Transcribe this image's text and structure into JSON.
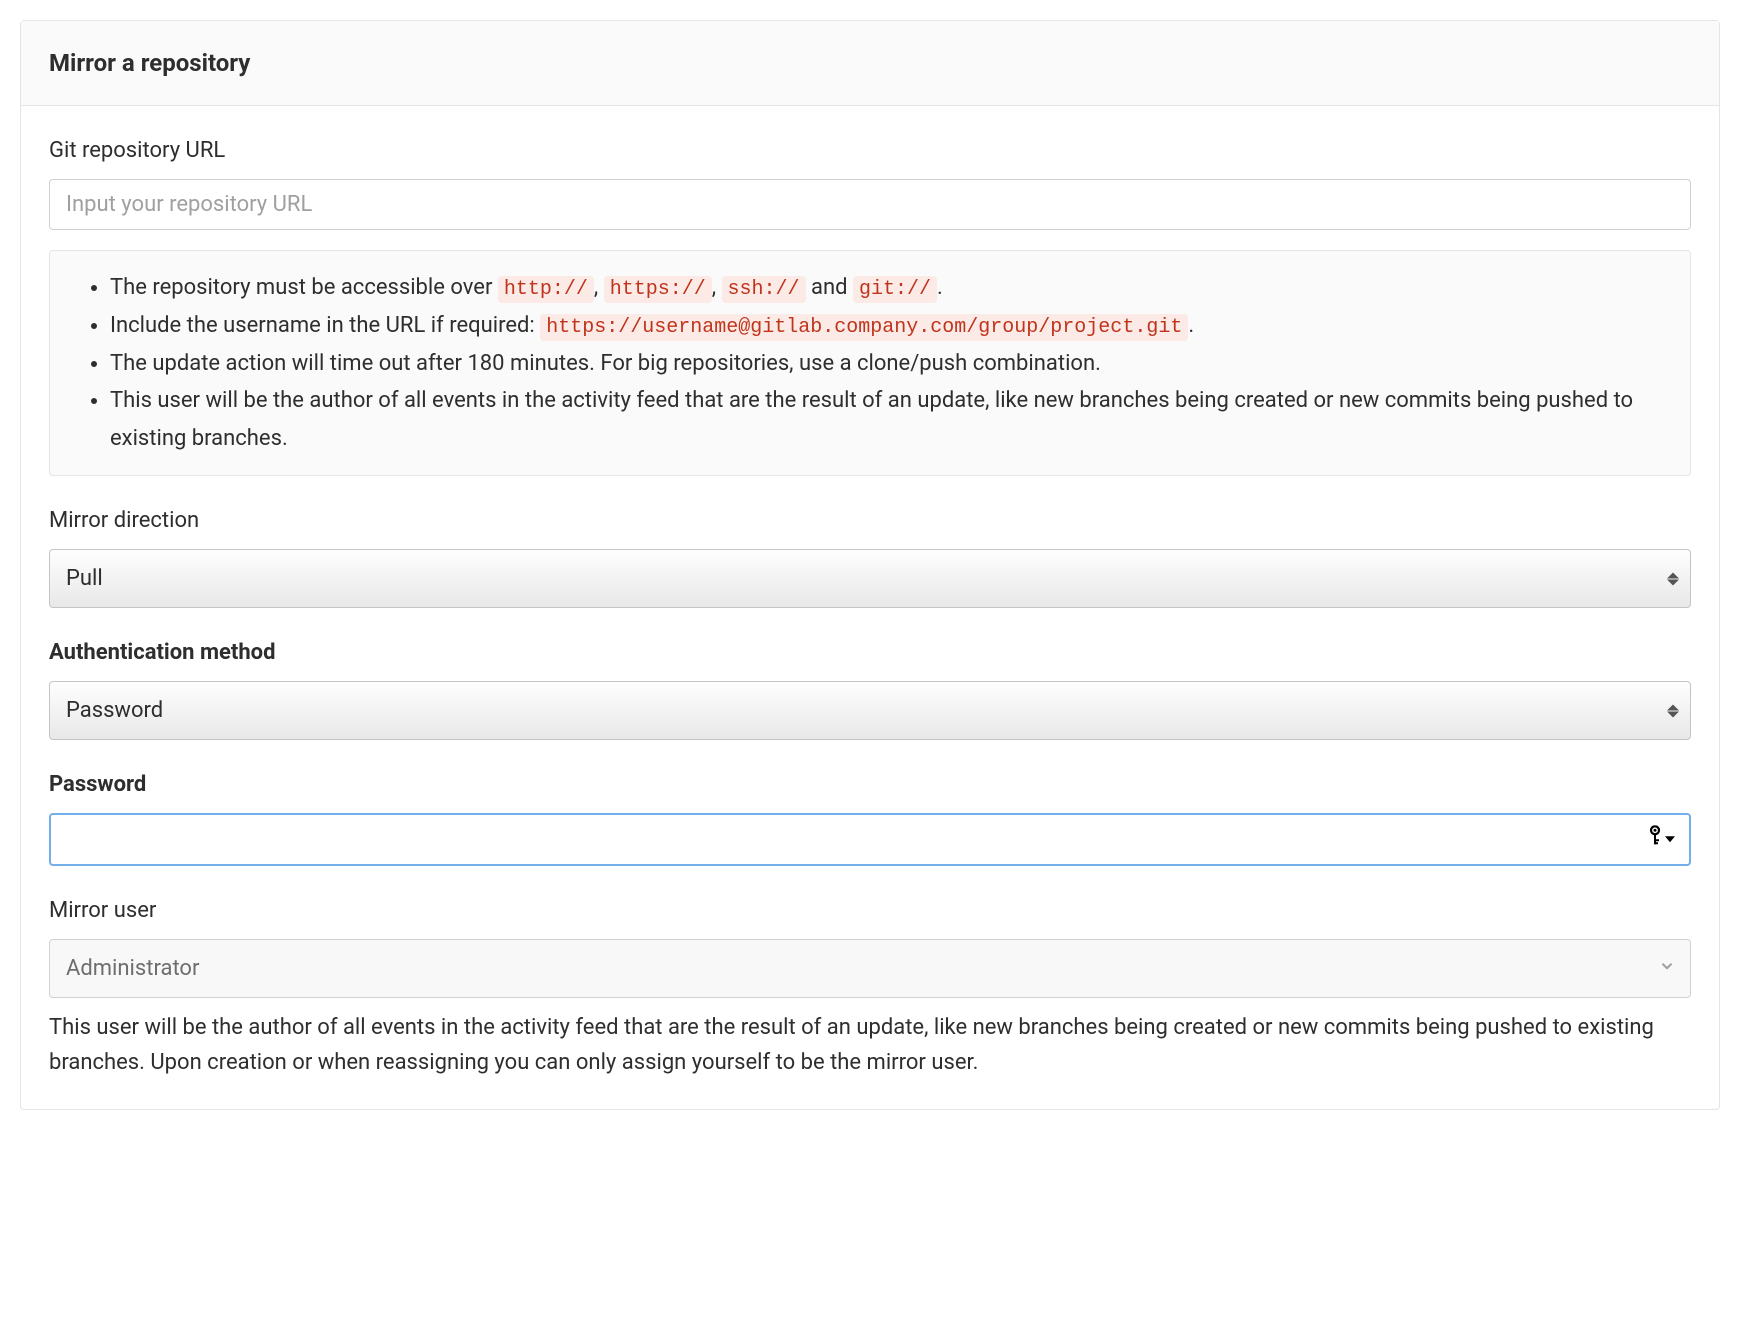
{
  "header": {
    "title": "Mirror a repository"
  },
  "url_field": {
    "label": "Git repository URL",
    "placeholder": "Input your repository URL",
    "value": ""
  },
  "info": {
    "item1_prefix": "The repository must be accessible over ",
    "item1_code1": "http://",
    "item1_sep1": ", ",
    "item1_code2": "https://",
    "item1_sep2": ", ",
    "item1_code3": "ssh://",
    "item1_sep3": " and ",
    "item1_code4": "git://",
    "item1_suffix": ".",
    "item2_prefix": "Include the username in the URL if required: ",
    "item2_code": "https://username@gitlab.company.com/group/project.git",
    "item2_suffix": ".",
    "item3": "The update action will time out after 180 minutes. For big repositories, use a clone/push combination.",
    "item4": "This user will be the author of all events in the activity feed that are the result of an update, like new branches being created or new commits being pushed to existing branches."
  },
  "mirror_direction": {
    "label": "Mirror direction",
    "selected": "Pull"
  },
  "auth_method": {
    "label": "Authentication method",
    "selected": "Password"
  },
  "password": {
    "label": "Password",
    "value": ""
  },
  "mirror_user": {
    "label": "Mirror user",
    "selected": "Administrator",
    "help": "This user will be the author of all events in the activity feed that are the result of an update, like new branches being created or new commits being pushed to existing branches. Upon creation or when reassigning you can only assign yourself to be the mirror user."
  }
}
